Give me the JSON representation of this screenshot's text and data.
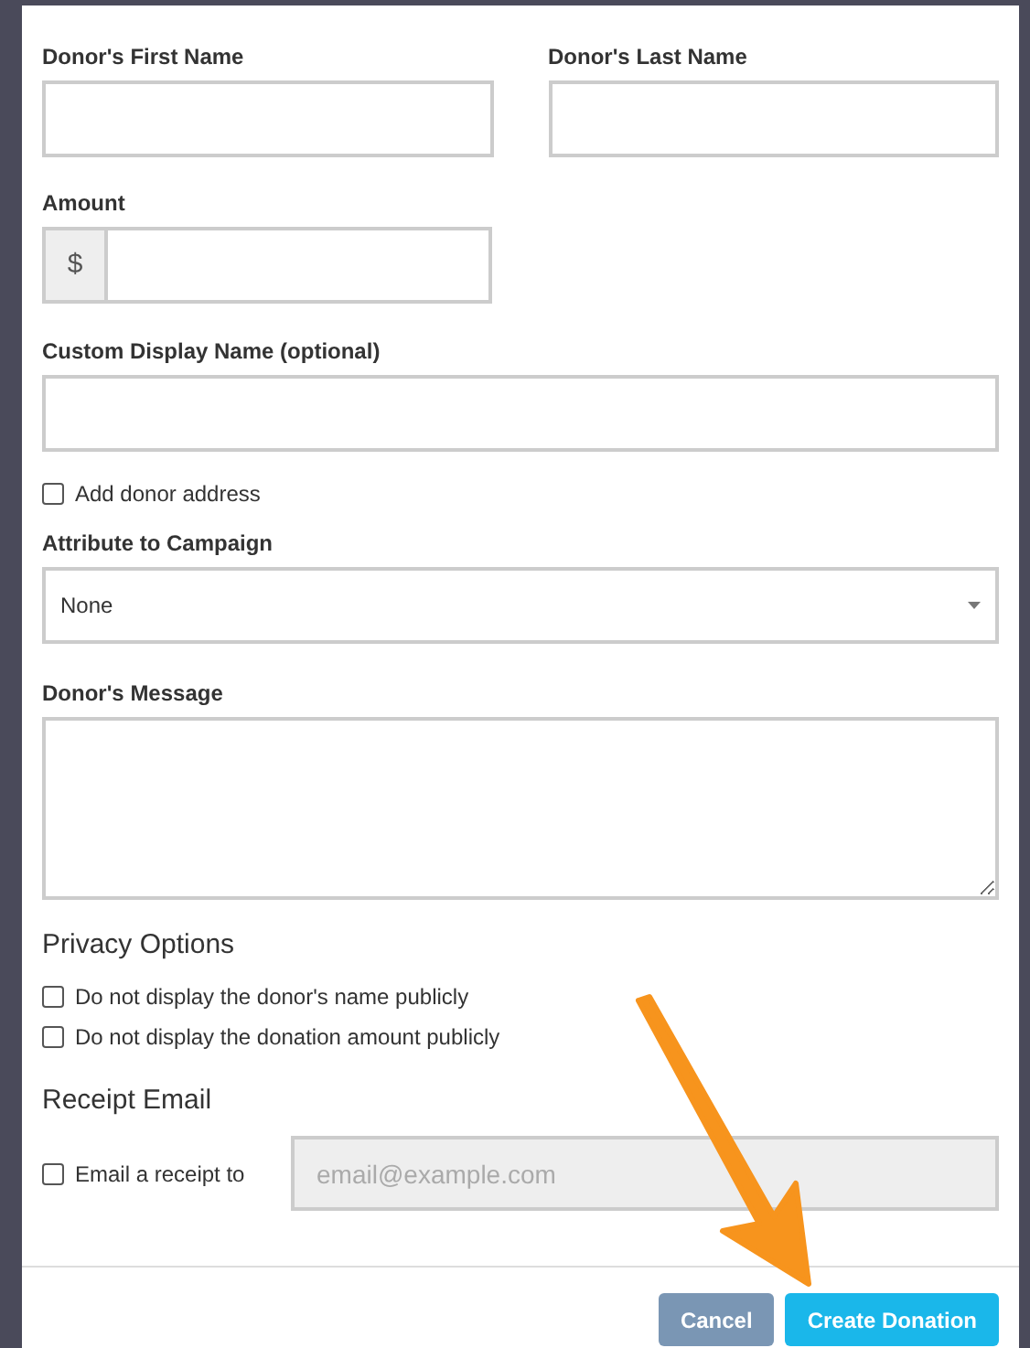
{
  "name_fields": [
    {
      "label": "Donor's First Name"
    },
    {
      "label": "Donor's Last Name"
    }
  ],
  "amount": {
    "label": "Amount",
    "prefix": "$"
  },
  "display_name": {
    "label": "Custom Display Name (optional)"
  },
  "address_option": {
    "label": "Add donor address",
    "checked": false
  },
  "campaign": {
    "label": "Attribute to Campaign",
    "value": "None"
  },
  "message": {
    "label": "Donor's Message"
  },
  "privacy": {
    "title": "Privacy Options",
    "options": [
      {
        "label": "Do not display the donor's name publicly",
        "checked": false
      },
      {
        "label": "Do not display the donation amount publicly",
        "checked": false
      }
    ]
  },
  "receipt": {
    "title": "Receipt Email",
    "label": "Email a receipt to",
    "checked": false,
    "placeholder": "email@example.com",
    "disabled": true
  },
  "buttons": [
    {
      "label": "Cancel",
      "kind": "secondary"
    },
    {
      "label": "Create Donation",
      "kind": "primary"
    }
  ]
}
